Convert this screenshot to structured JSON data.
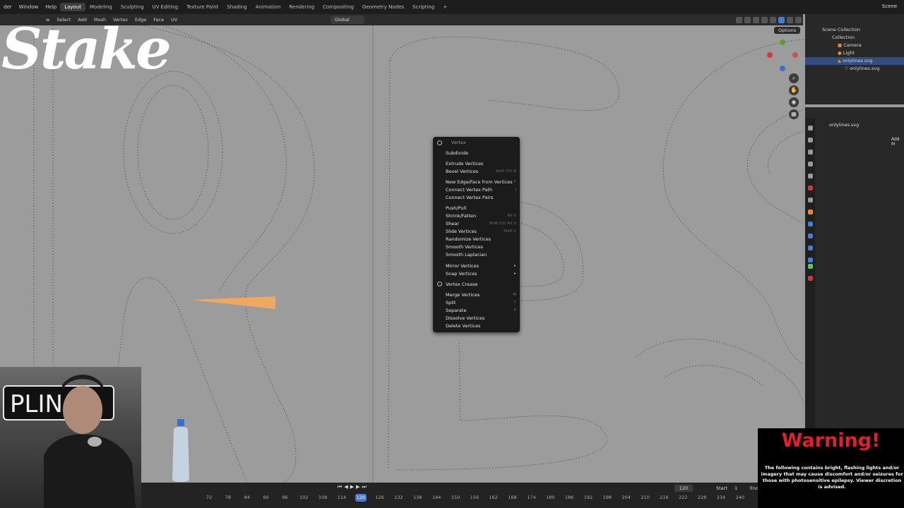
{
  "menubar": {
    "menus": [
      "der",
      "Window",
      "Help"
    ],
    "workspaces": [
      "Layout",
      "Modeling",
      "Sculpting",
      "UV Editing",
      "Texture Paint",
      "Shading",
      "Animation",
      "Rendering",
      "Compositing",
      "Geometry Nodes",
      "Scripting",
      "+"
    ],
    "active_workspace": "Layout",
    "scene": "Scene"
  },
  "viewport_header": {
    "menus": [
      "w",
      "Select",
      "Add",
      "Mesh",
      "Vertex",
      "Edge",
      "Face",
      "UV"
    ],
    "orientation": "Global",
    "options": "Options"
  },
  "context_menu": {
    "title": "Vertex",
    "items": [
      {
        "label": "Subdivide",
        "shortcut": ""
      },
      {
        "label": "Extrude Vertices",
        "shortcut": ""
      },
      {
        "label": "Bevel Vertices",
        "shortcut": "Shift Ctrl B"
      },
      {
        "label": "New Edge/Face from Vertices",
        "shortcut": "F"
      },
      {
        "label": "Connect Vertex Path",
        "shortcut": "J"
      },
      {
        "label": "Connect Vertex Pairs",
        "shortcut": ""
      },
      {
        "label": "Push/Pull",
        "shortcut": ""
      },
      {
        "label": "Shrink/Fatten",
        "shortcut": "Alt S"
      },
      {
        "label": "Shear",
        "shortcut": "Shift Ctrl Alt S"
      },
      {
        "label": "Slide Vertices",
        "shortcut": "Shift V"
      },
      {
        "label": "Randomize Vertices",
        "shortcut": ""
      },
      {
        "label": "Smooth Vertices",
        "shortcut": ""
      },
      {
        "label": "Smooth Laplacian",
        "shortcut": ""
      },
      {
        "label": "Mirror Vertices",
        "shortcut": ""
      },
      {
        "label": "Snap Vertices",
        "shortcut": ""
      },
      {
        "label": "Vertex Crease",
        "shortcut": ""
      },
      {
        "label": "Merge Vertices",
        "shortcut": "M"
      },
      {
        "label": "Split",
        "shortcut": "Y"
      },
      {
        "label": "Separate",
        "shortcut": "P"
      },
      {
        "label": "Dissolve Vertices",
        "shortcut": ""
      },
      {
        "label": "Delete Vertices",
        "shortcut": ""
      }
    ]
  },
  "outliner": {
    "rows": [
      {
        "label": "Scene Collection",
        "selected": false
      },
      {
        "label": "Collection",
        "selected": false
      },
      {
        "label": "Camera",
        "selected": false
      },
      {
        "label": "Light",
        "selected": false
      },
      {
        "label": "onlylines.svg",
        "selected": true
      },
      {
        "label": "onlylines.svg",
        "selected": false
      }
    ]
  },
  "properties": {
    "object_name": "onlylines.svg",
    "add_label": "Add M"
  },
  "timeline": {
    "ticks": [
      "72",
      "78",
      "84",
      "90",
      "96",
      "102",
      "108",
      "114",
      "120",
      "126",
      "132",
      "138",
      "144",
      "150",
      "156",
      "162",
      "168",
      "174",
      "180",
      "186",
      "192",
      "198",
      "204",
      "210",
      "216",
      "222",
      "228",
      "234",
      "240"
    ],
    "current_frame": "120",
    "frame_field": "120",
    "start_label": "Start",
    "start_value": "1",
    "end_label": "End"
  },
  "overlay": {
    "logo": "Stake",
    "sign": "PLIN",
    "warning_title": "Warning!",
    "warning_body": "The following contains bright, flashing lights and/or imagery that may cause discomfort and/or seizures for those with photosensitive epilepsy. Viewer discretion is advised."
  },
  "colors": {
    "accent": "#4a7bd4",
    "warning_red": "#e0202a",
    "selection": "#334d80"
  }
}
